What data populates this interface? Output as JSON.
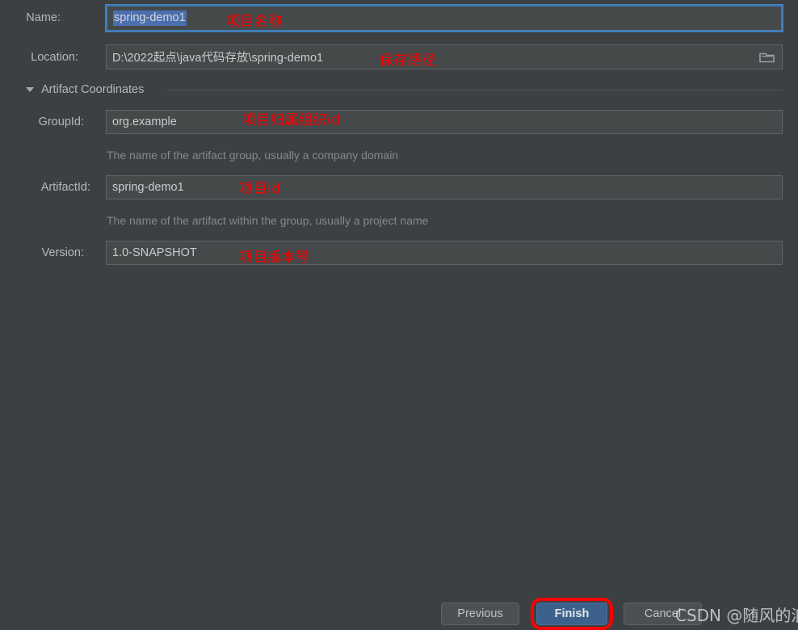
{
  "dialog": {
    "background_color": "#3c4043"
  },
  "fields": {
    "name": {
      "label": "Name:",
      "value": "spring-demo1",
      "selected": true,
      "focused": true
    },
    "location": {
      "label": "Location:",
      "value": "D:\\2022起点\\java代码存放\\spring-demo1",
      "browse_icon": "folder-icon"
    },
    "group_id": {
      "label": "GroupId:",
      "value": "org.example",
      "hint": "The name of the artifact group, usually a company domain"
    },
    "artifact_id": {
      "label": "ArtifactId:",
      "value": "spring-demo1",
      "hint": "The name of the artifact within the group, usually a project name"
    },
    "version": {
      "label": "Version:",
      "value": "1.0-SNAPSHOT"
    }
  },
  "section": {
    "title": "Artifact Coordinates",
    "expanded": true,
    "toggle_icon": "chevron-down-icon"
  },
  "annotations": [
    {
      "text": "项目名称",
      "color": "#ff0000"
    },
    {
      "text": "保存路径",
      "color": "#ff0000"
    },
    {
      "text": "项目归属组织id",
      "color": "#ff0000"
    },
    {
      "text": "项目id",
      "color": "#ff0000"
    },
    {
      "text": "项目版本号",
      "color": "#ff0000"
    }
  ],
  "buttons": {
    "previous": "Previous",
    "finish": "Finish",
    "cancel": "Cancel",
    "finish_accent_color": "#3c628c",
    "highlight_color": "#ff0000"
  },
  "watermark": {
    "text": "CSDN @随风的浪"
  }
}
